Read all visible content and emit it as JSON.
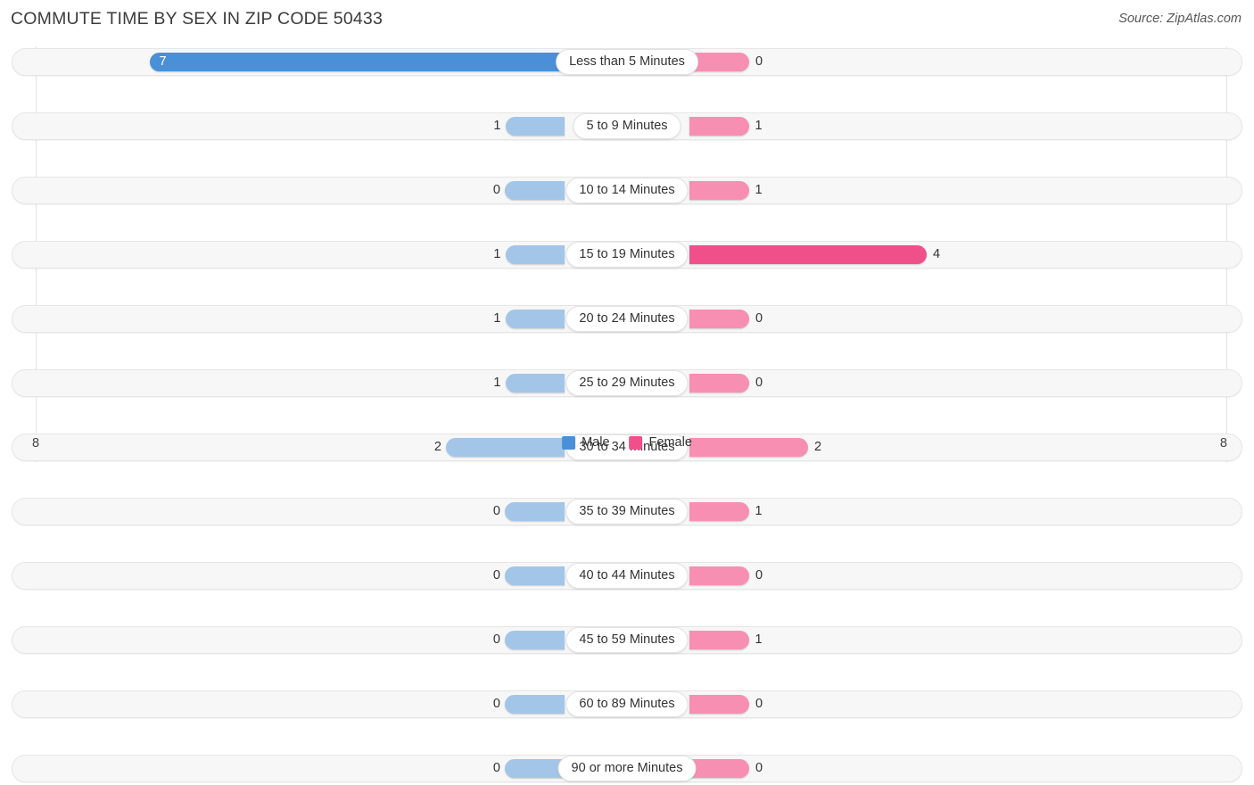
{
  "header": {
    "title": "COMMUTE TIME BY SEX IN ZIP CODE 50433",
    "source": "Source: ZipAtlas.com"
  },
  "legend": {
    "male_label": "Male",
    "female_label": "Female"
  },
  "axis": {
    "left_max_label": "8",
    "right_max_label": "8"
  },
  "colors": {
    "male_strong": "#4a90d9",
    "male_light": "#a3c6e8",
    "female_strong": "#f0508a",
    "female_light": "#f78fb3",
    "track": "#f7f7f7"
  },
  "chart_data": {
    "type": "bar",
    "title": "COMMUTE TIME BY SEX IN ZIP CODE 50433",
    "subtitle": "Source: ZipAtlas.com",
    "orientation": "horizontal-diverging",
    "xlabel": "",
    "ylabel": "",
    "xlim": [
      8,
      8
    ],
    "grid": true,
    "legend_position": "bottom-center",
    "categories": [
      "Less than 5 Minutes",
      "5 to 9 Minutes",
      "10 to 14 Minutes",
      "15 to 19 Minutes",
      "20 to 24 Minutes",
      "25 to 29 Minutes",
      "30 to 34 Minutes",
      "35 to 39 Minutes",
      "40 to 44 Minutes",
      "45 to 59 Minutes",
      "60 to 89 Minutes",
      "90 or more Minutes"
    ],
    "series": [
      {
        "name": "Male",
        "side": "left",
        "values": [
          7,
          1,
          0,
          1,
          1,
          1,
          2,
          0,
          0,
          0,
          0,
          0
        ]
      },
      {
        "name": "Female",
        "side": "right",
        "values": [
          0,
          1,
          1,
          4,
          0,
          0,
          2,
          1,
          0,
          1,
          0,
          0
        ]
      }
    ],
    "value_labels": {
      "male": [
        "7",
        "1",
        "0",
        "1",
        "1",
        "1",
        "2",
        "0",
        "0",
        "0",
        "0",
        "0"
      ],
      "female": [
        "0",
        "1",
        "1",
        "4",
        "0",
        "0",
        "2",
        "1",
        "0",
        "1",
        "0",
        "0"
      ]
    }
  }
}
